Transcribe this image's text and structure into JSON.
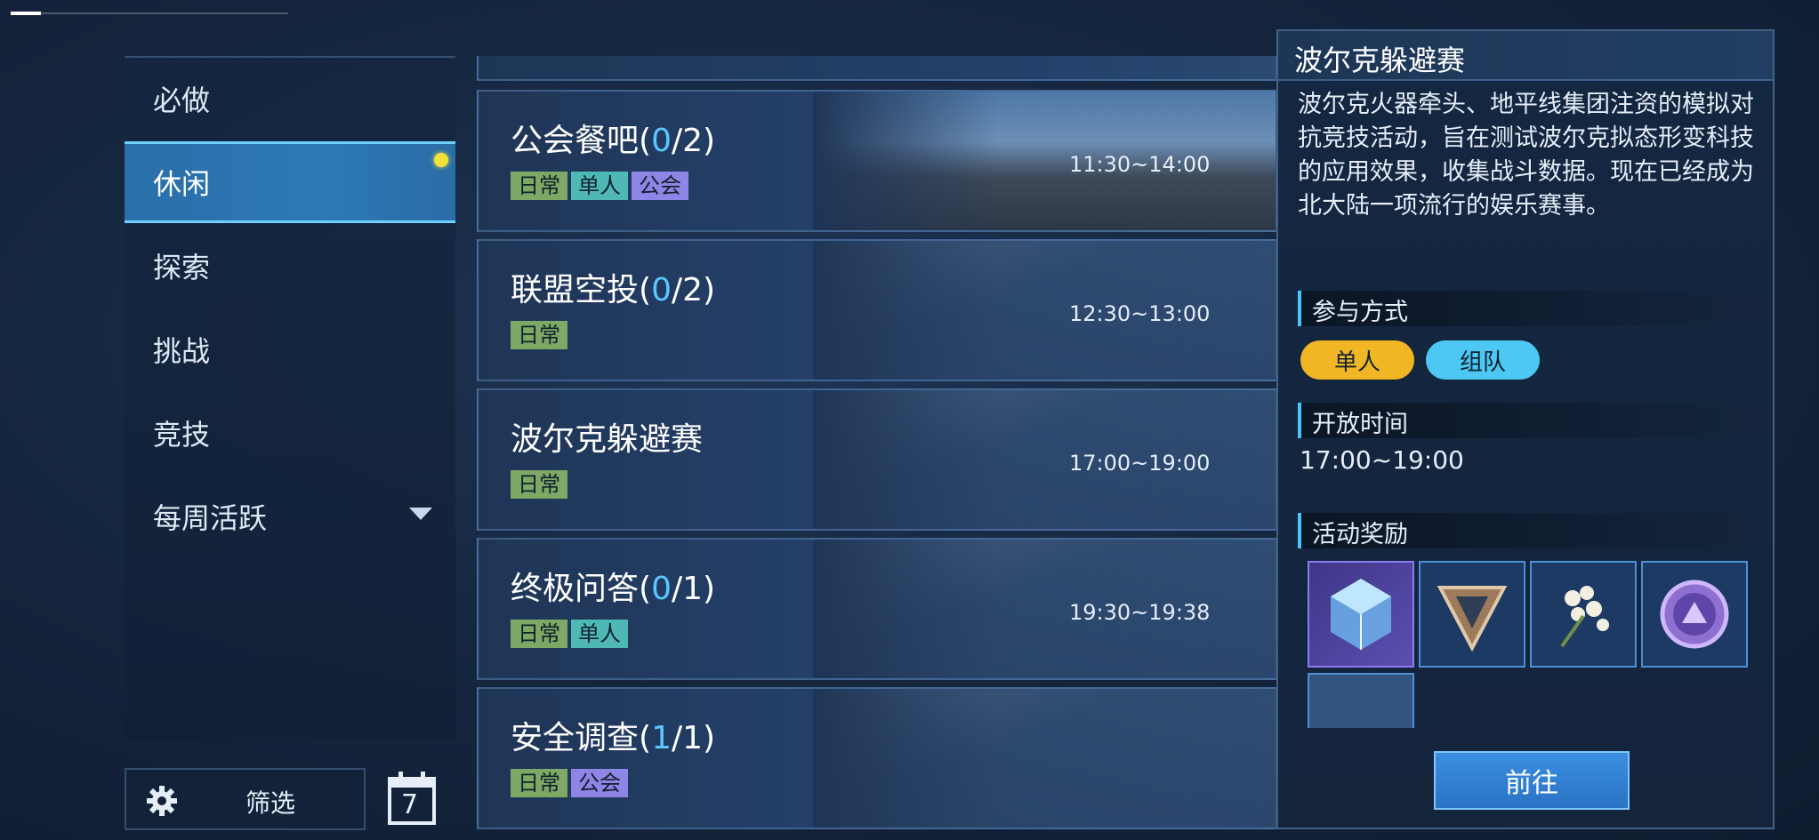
{
  "sidebar": {
    "items": [
      {
        "label": "必做"
      },
      {
        "label": "休闲"
      },
      {
        "label": "探索"
      },
      {
        "label": "挑战"
      },
      {
        "label": "竞技"
      },
      {
        "label": "每周活跃"
      }
    ],
    "active_index": 1,
    "filter_label": "筛选",
    "calendar_day": "7"
  },
  "activities": [
    {
      "name": "公会餐吧",
      "count": "0/2",
      "time": "11:30~14:00",
      "tags": [
        "日常",
        "单人",
        "公会"
      ]
    },
    {
      "name": "联盟空投",
      "count": "0/2",
      "time": "12:30~13:00",
      "tags": [
        "日常"
      ]
    },
    {
      "name": "波尔克躲避赛",
      "count": "",
      "time": "17:00~19:00",
      "tags": [
        "日常"
      ]
    },
    {
      "name": "终极问答",
      "count": "0/1",
      "time": "19:30~19:38",
      "tags": [
        "日常",
        "单人"
      ]
    },
    {
      "name": "安全调查",
      "count": "1/1",
      "time": "",
      "tags": [
        "日常",
        "公会"
      ]
    }
  ],
  "detail": {
    "title": "波尔克躲避赛",
    "description": "波尔克火器牵头、地平线集团注资的模拟对抗竞技活动，旨在测试波尔克拟态形变科技的应用效果，收集战斗数据。现在已经成为北大陆一项流行的娱乐赛事。",
    "participation_heading": "参与方式",
    "modes": [
      "单人",
      "组队"
    ],
    "open_time_heading": "开放时间",
    "open_time": "17:00~19:00",
    "rewards_heading": "活动奖励",
    "goto_label": "前往"
  },
  "colors": {
    "accent_blue": "#5bc6ff",
    "tag_daily": "#7ea865",
    "tag_solo": "#4fb8b4",
    "tag_guild": "#8e86e6",
    "pill_solo": "#f0b624",
    "pill_team": "#4dc8f4",
    "notification_dot": "#f4e23a"
  }
}
